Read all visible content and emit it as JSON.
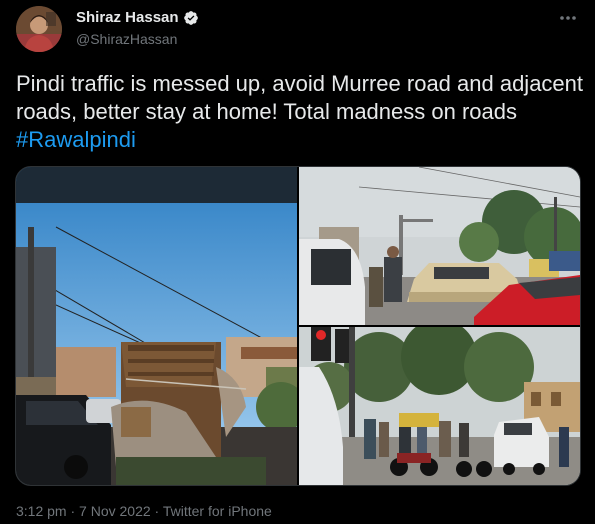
{
  "author": {
    "display_name": "Shiraz Hassan",
    "handle": "@ShirazHassan",
    "verified": true
  },
  "tweet": {
    "text_before": "Pindi traffic is messed up, avoid Murree road and adjacent roads, better stay at home! Total madness on roads ",
    "hashtag": "#Rawalpindi"
  },
  "media": {
    "photo_count": 3
  },
  "meta": {
    "time": "3:12 pm",
    "date": "7 Nov 2022",
    "client": "Twitter for iPhone",
    "separator": "·"
  },
  "icons": {
    "verified": "verified-badge-icon",
    "more": "more-options-icon"
  },
  "colors": {
    "background": "#000000",
    "text": "#e7e9ea",
    "secondary": "#71767b",
    "link": "#1d9bf0"
  }
}
